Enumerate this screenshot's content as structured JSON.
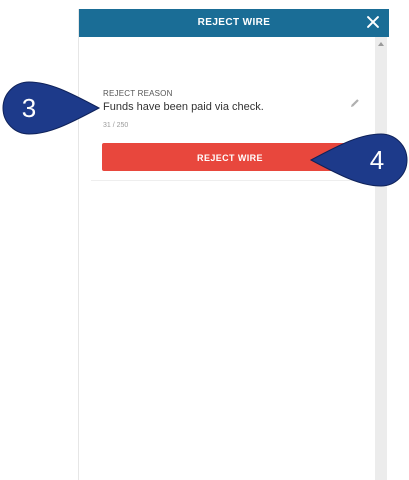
{
  "header": {
    "title": "REJECT WIRE",
    "close_icon": "close-icon",
    "background_color": "#1a6d96"
  },
  "form": {
    "reason_label": "REJECT REASON",
    "reason_value": "Funds have been paid via check.",
    "char_count": "31 / 250",
    "edit_icon": "pencil-icon"
  },
  "actions": {
    "reject_button_label": "REJECT WIRE",
    "reject_button_color": "#e8473d"
  },
  "callouts": {
    "left_number": "3",
    "right_number": "4",
    "color": "#1d3a8a"
  }
}
